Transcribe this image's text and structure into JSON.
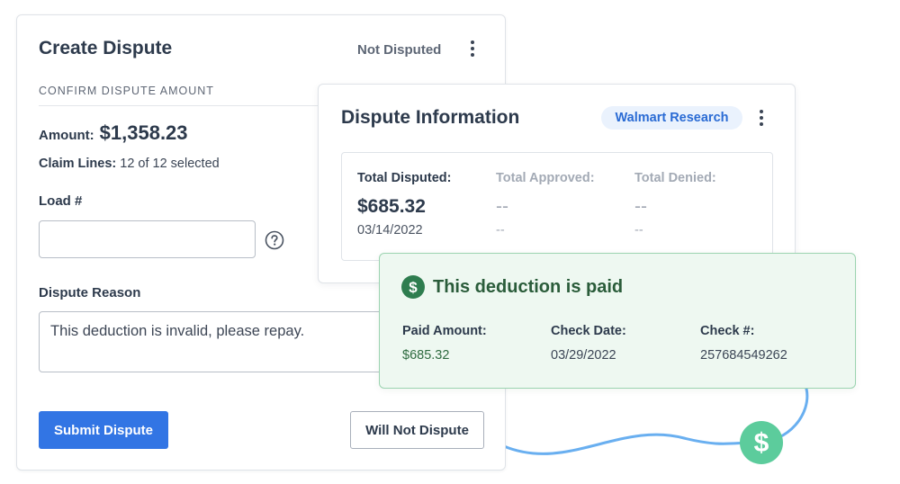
{
  "create_dispute": {
    "title": "Create Dispute",
    "status": "Not Disputed",
    "section_label": "CONFIRM DISPUTE AMOUNT",
    "amount_label": "Amount:",
    "amount_value": "$1,358.23",
    "claim_lines_label": "Claim Lines:",
    "claim_lines_value": "12 of 12 selected",
    "load_label": "Load #",
    "load_value": "",
    "dispute_reason_label": "Dispute Reason",
    "dispute_reason_value": "This deduction is invalid, please repay.",
    "submit_label": "Submit Dispute",
    "will_not_dispute_label": "Will Not Dispute"
  },
  "dispute_info": {
    "title": "Dispute Information",
    "badge": "Walmart Research",
    "total_disputed": {
      "label": "Total Disputed:",
      "value": "$685.32",
      "date": "03/14/2022"
    },
    "total_approved": {
      "label": "Total Approved:",
      "value": "--",
      "date": "--"
    },
    "total_denied": {
      "label": "Total Denied:",
      "value": "--",
      "date": "--"
    }
  },
  "paid": {
    "title": "This deduction is paid",
    "paid_amount": {
      "label": "Paid Amount:",
      "value": "$685.32"
    },
    "check_date": {
      "label": "Check Date:",
      "value": "03/29/2022"
    },
    "check_number": {
      "label": "Check #:",
      "value": "257684549262"
    }
  },
  "icons": {
    "kebab": "vertical-ellipsis-icon",
    "help": "question-circle-icon",
    "dollar": "dollar-circle-icon",
    "coin": "dollar-coin-icon"
  },
  "colors": {
    "primary_blue": "#3275e4",
    "badge_bg": "#eaf2fd",
    "badge_text": "#2a6bd4",
    "paid_bg": "#eef8f1",
    "paid_border": "#9bd3b0",
    "paid_icon": "#2e7d4f",
    "coin": "#5ccc9c",
    "curve": "#69aff0"
  }
}
